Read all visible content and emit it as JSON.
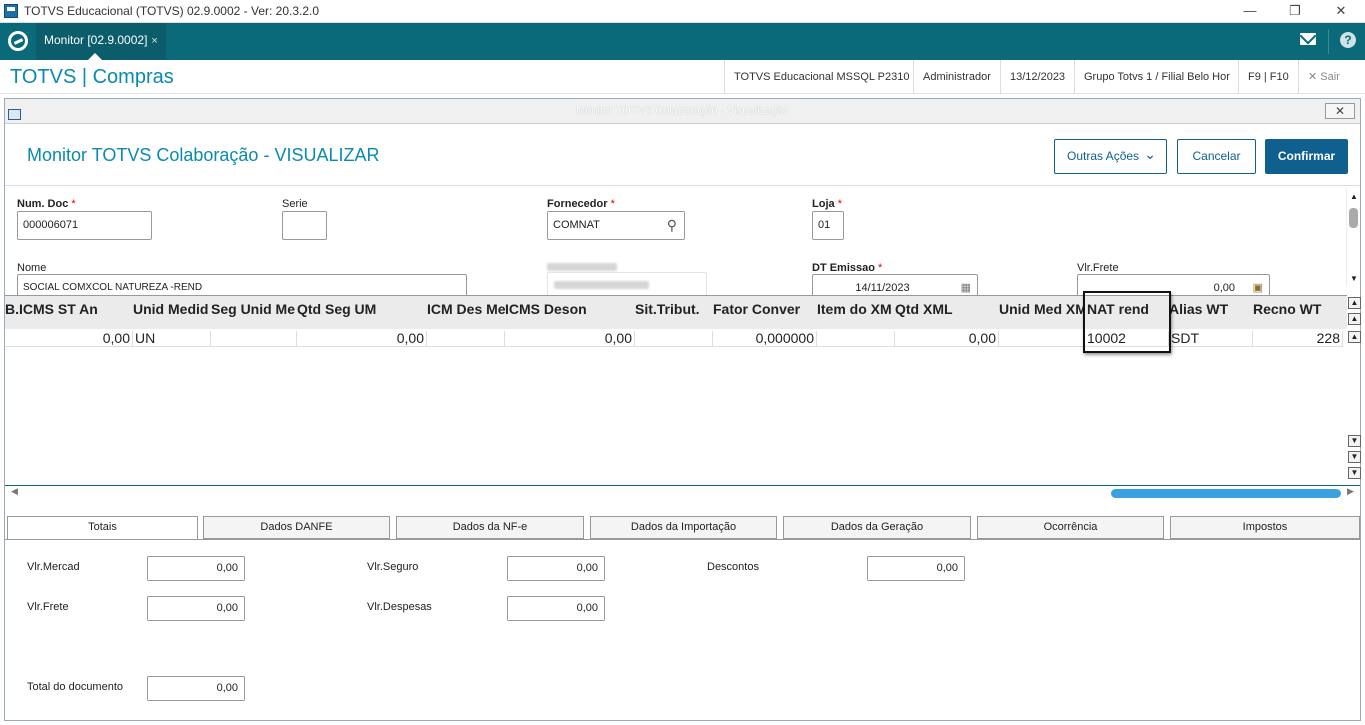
{
  "window": {
    "title": "TOTVS Educacional (TOTVS) 02.9.0002 - Ver: 20.3.2.0"
  },
  "tabbar": {
    "tab_label": "Monitor [02.9.0002]",
    "tab_close": "×"
  },
  "header": {
    "brand": "TOTVS | Compras",
    "environment": "TOTVS Educacional MSSQL P2310",
    "user": "Administrador",
    "date": "13/12/2023",
    "company": "Grupo Totvs 1 / Filial Belo Hor",
    "shortcut": "F9 | F10",
    "exit": "Sair"
  },
  "dialog": {
    "title": "Monitor TOTVS Colaboração - Visualização",
    "page_title": "Monitor TOTVS Colaboração - VISUALIZAR",
    "buttons": {
      "other": "Outras Ações",
      "cancel": "Cancelar",
      "confirm": "Confirmar"
    }
  },
  "form": {
    "num_doc": {
      "label": "Num. Doc",
      "value": "000006071"
    },
    "serie": {
      "label": "Serie",
      "value": ""
    },
    "fornecedor": {
      "label": "Fornecedor",
      "value": "COMNAT"
    },
    "loja": {
      "label": "Loja",
      "value": "01"
    },
    "nome": {
      "label": "Nome",
      "value": "SOCIAL  COMXCOL NATUREZA -REND"
    },
    "dt_emissao": {
      "label": "DT Emissao",
      "value": "14/11/2023"
    },
    "vlr_frete": {
      "label": "Vlr.Frete",
      "value": "0,00"
    }
  },
  "grid": {
    "headers": [
      "B.ICMS ST An",
      "Unid Medid",
      "Seg Unid Me",
      "Qtd Seg UM",
      "ICM Des Me",
      "ICMS Deson",
      "Sit.Tribut.",
      "Fator Conver",
      "Item do XM",
      "Qtd XML",
      "Unid Med XM",
      "NAT rend",
      "Alias WT",
      "Recno WT"
    ],
    "row": [
      "0,00",
      "UN",
      "",
      "0,00",
      "",
      "0,00",
      "",
      "0,000000",
      "",
      "0,00",
      "",
      "10002",
      "SDT",
      "228"
    ]
  },
  "tabs": [
    "Totais",
    "Dados DANFE",
    "Dados da NF-e",
    "Dados da Importação",
    "Dados da Geração",
    "Ocorrência",
    "Impostos"
  ],
  "totais": {
    "vlr_mercad": {
      "label": "Vlr.Mercad",
      "value": "0,00"
    },
    "vlr_seguro": {
      "label": "Vlr.Seguro",
      "value": "0,00"
    },
    "descontos": {
      "label": "Descontos",
      "value": "0,00"
    },
    "vlr_frete": {
      "label": "Vlr.Frete",
      "value": "0,00"
    },
    "vlr_despesas": {
      "label": "Vlr.Despesas",
      "value": "0,00"
    },
    "total_documento": {
      "label": "Total do documento",
      "value": "0,00"
    }
  },
  "colors": {
    "teal": "#0a6a7a",
    "brand": "#0a8ab0",
    "primary": "#0f5f8f"
  }
}
